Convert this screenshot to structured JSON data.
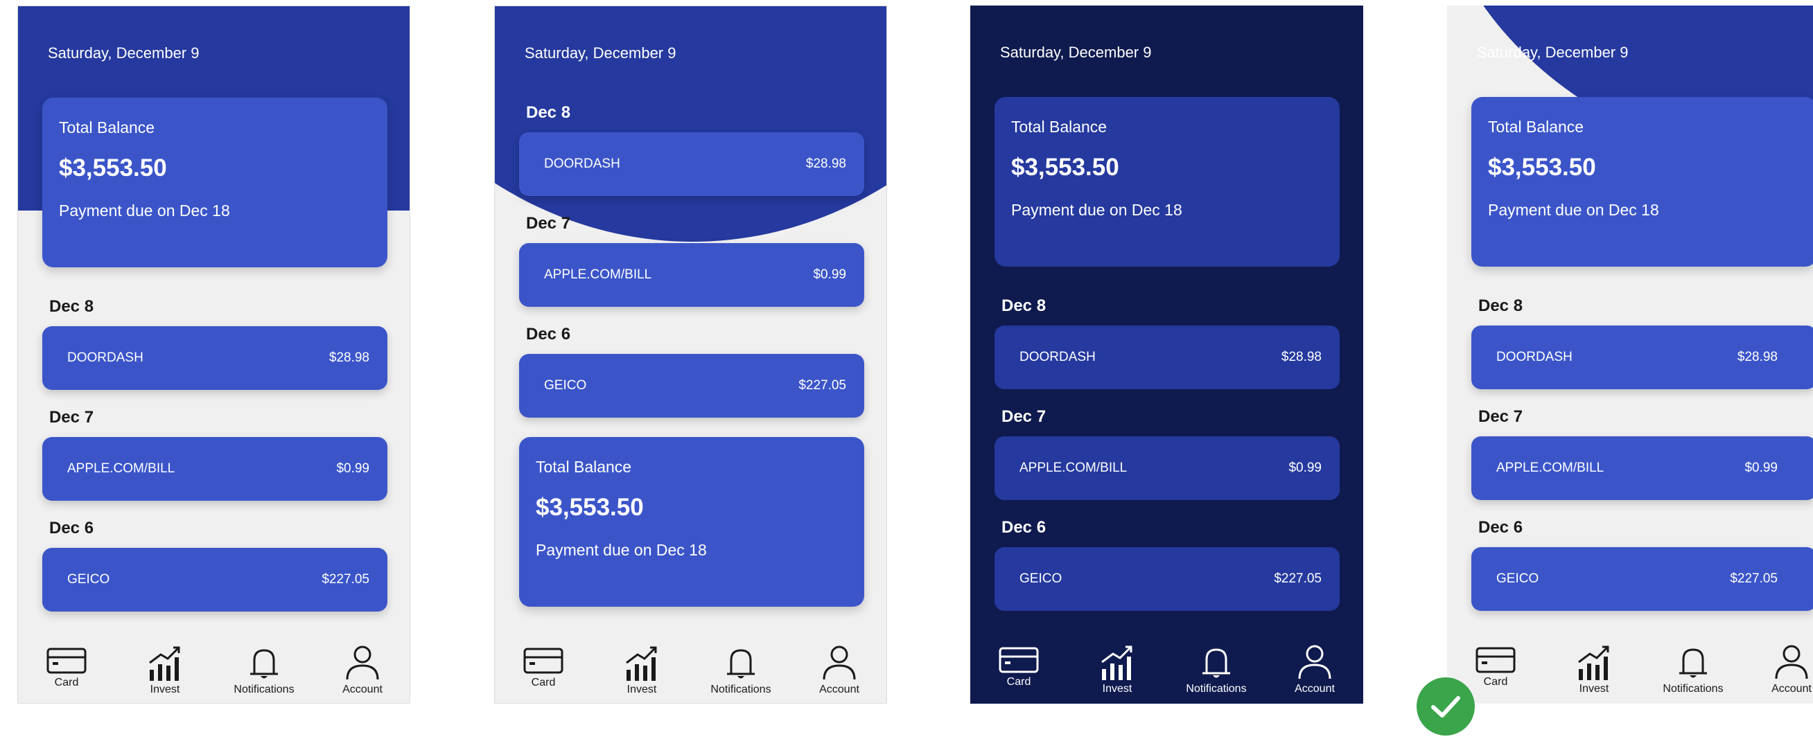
{
  "date": "Saturday, December 9",
  "balance": {
    "label": "Total Balance",
    "amount": "$3,553.50",
    "due": "Payment due on Dec 18"
  },
  "transactions": [
    {
      "day": "Dec 8",
      "name": "DOORDASH",
      "amount": "$28.98"
    },
    {
      "day": "Dec 7",
      "name": "APPLE.COM/BILL",
      "amount": "$0.99"
    },
    {
      "day": "Dec 6",
      "name": "GEICO",
      "amount": "$227.05"
    }
  ],
  "nav": {
    "card": "Card",
    "invest": "Invest",
    "notifications": "Notifications",
    "account": "Account"
  },
  "colors": {
    "header_blue": "#25399e",
    "card_blue": "#3b55c9",
    "dark_bg": "#0f1a4e",
    "light_bg": "#f0f0f0",
    "selected_badge": "#3aa54a"
  },
  "selected_variant": "4"
}
